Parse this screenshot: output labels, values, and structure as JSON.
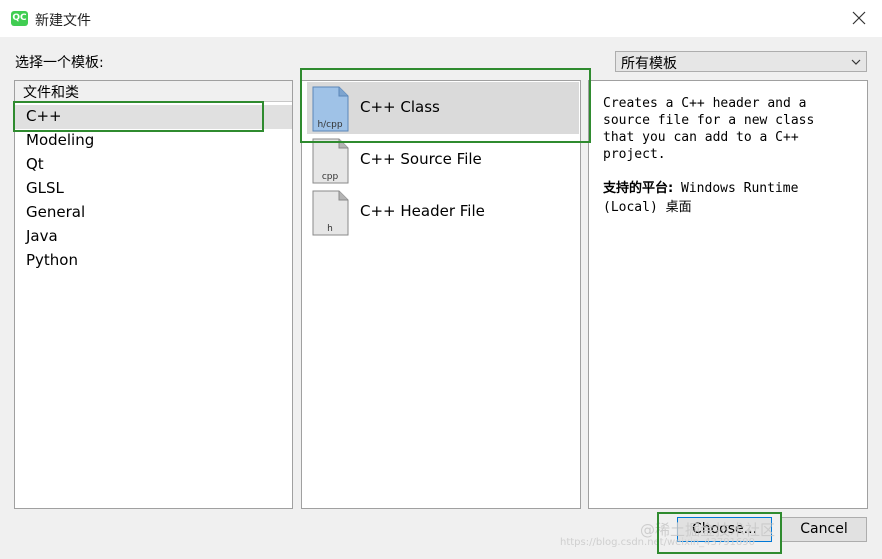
{
  "window": {
    "app_icon_text": "QC",
    "title": "新建文件"
  },
  "labels": {
    "choose_template": "选择一个模板:",
    "filter_value": "所有模板"
  },
  "categories": {
    "header": "文件和类",
    "items": [
      "C++",
      "Modeling",
      "Qt",
      "GLSL",
      "General",
      "Java",
      "Python"
    ],
    "selected_index": 0
  },
  "templates": {
    "items": [
      {
        "label": "C++ Class",
        "icon_text": "h/cpp",
        "icon": "file-h-cpp-icon"
      },
      {
        "label": "C++ Source File",
        "icon_text": "cpp",
        "icon": "file-cpp-icon"
      },
      {
        "label": "C++ Header File",
        "icon_text": "h",
        "icon": "file-h-icon"
      }
    ],
    "selected_index": 0
  },
  "description": {
    "text": "Creates a C++ header and a\nsource file for a new class\nthat you can add to a C++\nproject.",
    "platforms_label": "支持的平台:",
    "platforms_value": "Windows Runtime (Local) 桌面"
  },
  "buttons": {
    "choose": "Choose...",
    "cancel": "Cancel"
  },
  "watermark": {
    "text": "@稀土掘金技术社区",
    "url_text": "https://blog.csdn.net/weixin_43791690"
  },
  "colors": {
    "highlight": "#2f8b2f",
    "selected_icon": "#9fc2e7"
  }
}
